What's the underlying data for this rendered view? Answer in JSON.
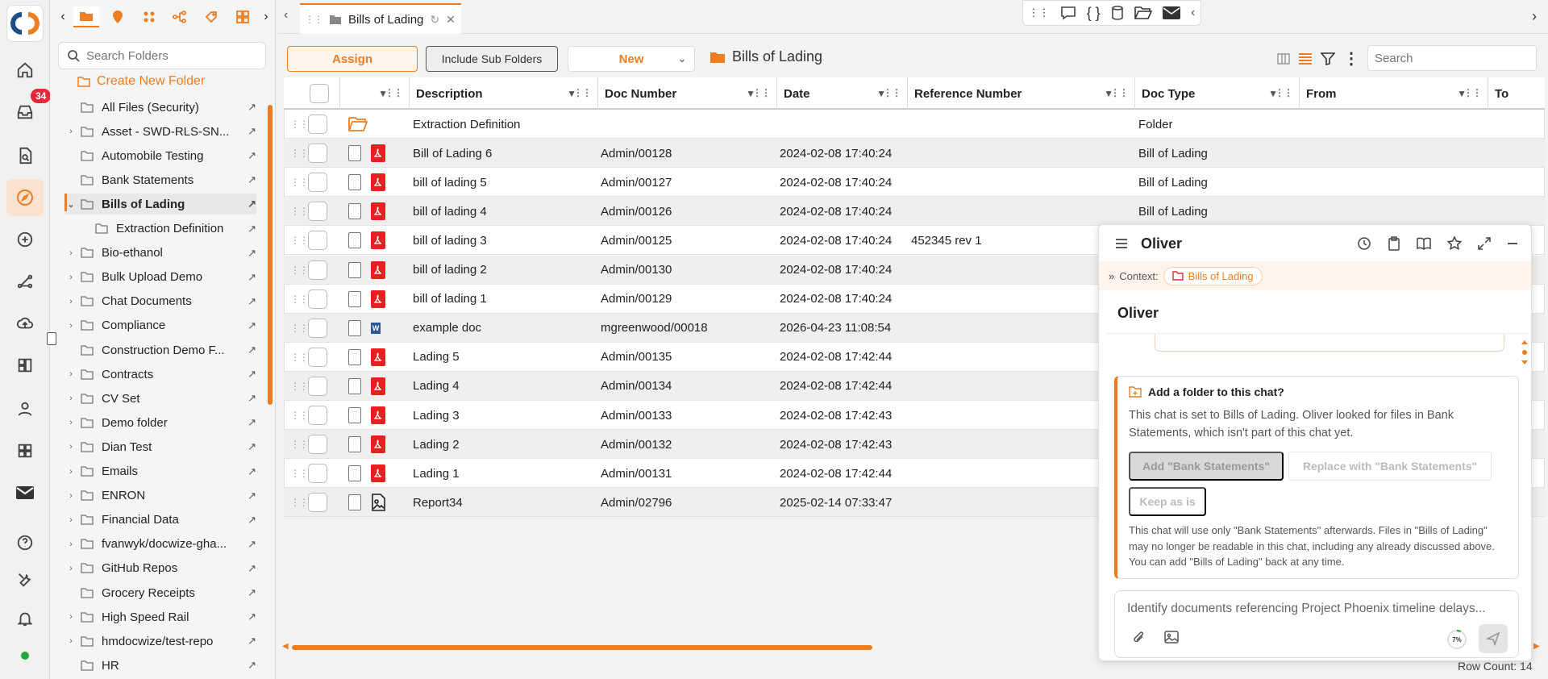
{
  "folder_panel": {
    "search_placeholder": "Search Folders",
    "create_label": "Create New Folder",
    "items": [
      {
        "label": "All Files (Security)",
        "expandable": false
      },
      {
        "label": "Asset - SWD-RLS-SN...",
        "expandable": true
      },
      {
        "label": "Automobile Testing",
        "expandable": false
      },
      {
        "label": "Bank Statements",
        "expandable": false
      },
      {
        "label": "Bills of Lading",
        "expandable": true
      },
      {
        "label": "Extraction Definition",
        "expandable": false
      },
      {
        "label": "Bio-ethanol",
        "expandable": true
      },
      {
        "label": "Bulk Upload Demo",
        "expandable": true
      },
      {
        "label": "Chat Documents",
        "expandable": true
      },
      {
        "label": "Compliance",
        "expandable": true
      },
      {
        "label": "Construction Demo F...",
        "expandable": false
      },
      {
        "label": "Contracts",
        "expandable": true
      },
      {
        "label": "CV Set",
        "expandable": true
      },
      {
        "label": "Demo folder",
        "expandable": true
      },
      {
        "label": "Dian Test",
        "expandable": true
      },
      {
        "label": "Emails",
        "expandable": true
      },
      {
        "label": "ENRON",
        "expandable": true
      },
      {
        "label": "Financial Data",
        "expandable": true
      },
      {
        "label": "fvanwyk/docwize-gha...",
        "expandable": true
      },
      {
        "label": "GitHub Repos",
        "expandable": true
      },
      {
        "label": "Grocery Receipts",
        "expandable": false
      },
      {
        "label": "High Speed Rail",
        "expandable": true
      },
      {
        "label": "hmdocwize/test-repo",
        "expandable": true
      },
      {
        "label": "HR",
        "expandable": false
      }
    ]
  },
  "rail": {
    "inbox_badge": "34"
  },
  "tab": {
    "label": "Bills of Lading"
  },
  "actions": {
    "assign": "Assign",
    "include_sub": "Include Sub Folders",
    "new": "New",
    "breadcrumb": "Bills of Lading",
    "search_placeholder": "Search"
  },
  "grid": {
    "columns": [
      "Description",
      "Doc Number",
      "Date",
      "Reference Number",
      "Doc Type",
      "From",
      "To"
    ],
    "rows": [
      {
        "icon": "folder",
        "description": "Extraction Definition",
        "doc_number": "",
        "date": "",
        "reference": "",
        "doc_type": "Folder"
      },
      {
        "icon": "pdf",
        "description": "Bill of Lading 6",
        "doc_number": "Admin/00128",
        "date": "2024-02-08 17:40:24",
        "reference": "",
        "doc_type": "Bill of Lading"
      },
      {
        "icon": "pdf",
        "description": "bill of lading 5",
        "doc_number": "Admin/00127",
        "date": "2024-02-08 17:40:24",
        "reference": "",
        "doc_type": "Bill of Lading"
      },
      {
        "icon": "pdf",
        "description": "bill of lading 4",
        "doc_number": "Admin/00126",
        "date": "2024-02-08 17:40:24",
        "reference": "",
        "doc_type": "Bill of Lading"
      },
      {
        "icon": "pdf",
        "description": "bill of lading 3",
        "doc_number": "Admin/00125",
        "date": "2024-02-08 17:40:24",
        "reference": "452345 rev 1",
        "doc_type": ""
      },
      {
        "icon": "pdf",
        "description": "bill of lading 2",
        "doc_number": "Admin/00130",
        "date": "2024-02-08 17:40:24",
        "reference": "",
        "doc_type": ""
      },
      {
        "icon": "pdf",
        "description": "bill of lading 1",
        "doc_number": "Admin/00129",
        "date": "2024-02-08 17:40:24",
        "reference": "",
        "doc_type": ""
      },
      {
        "icon": "word",
        "description": "example doc",
        "doc_number": "mgreenwood/00018",
        "date": "2026-04-23 11:08:54",
        "reference": "",
        "doc_type": ""
      },
      {
        "icon": "pdf",
        "description": "Lading 5",
        "doc_number": "Admin/00135",
        "date": "2024-02-08 17:42:44",
        "reference": "",
        "doc_type": ""
      },
      {
        "icon": "pdf",
        "description": "Lading 4",
        "doc_number": "Admin/00134",
        "date": "2024-02-08 17:42:44",
        "reference": "",
        "doc_type": ""
      },
      {
        "icon": "pdf",
        "description": "Lading 3",
        "doc_number": "Admin/00133",
        "date": "2024-02-08 17:42:43",
        "reference": "",
        "doc_type": ""
      },
      {
        "icon": "pdf",
        "description": "Lading 2",
        "doc_number": "Admin/00132",
        "date": "2024-02-08 17:42:43",
        "reference": "",
        "doc_type": ""
      },
      {
        "icon": "pdf",
        "description": "Lading 1",
        "doc_number": "Admin/00131",
        "date": "2024-02-08 17:42:44",
        "reference": "",
        "doc_type": ""
      },
      {
        "icon": "image",
        "description": "Report34",
        "doc_number": "Admin/02796",
        "date": "2025-02-14 07:33:47",
        "reference": "",
        "doc_type": ""
      }
    ],
    "row_count": "Row Count: 14"
  },
  "chat": {
    "title": "Oliver",
    "context_label": "Context:",
    "context_chip": "Bills of Lading",
    "subtitle": "Oliver",
    "notice_title": "Add a folder to this chat?",
    "notice_body": "This chat is set to Bills of Lading. Oliver looked for files in Bank Statements, which isn't part of this chat yet.",
    "add_button": "Add \"Bank Statements\"",
    "replace_button": "Replace with \"Bank Statements\"",
    "keep_button": "Keep as is",
    "notice_footer": "This chat will use only \"Bank Statements\" afterwards. Files in \"Bills of Lading\" may no longer be readable in this chat, including any already discussed above. You can add \"Bills of Lading\" back at any time.",
    "input_text": "Identify documents referencing Project Phoenix timeline delays...",
    "progress_label": "7%",
    "progress_value": 0.07
  },
  "colors": {
    "accent": "#ef7d22",
    "badge": "#e8273a",
    "pdf": "#e62020",
    "online": "#1fa83a"
  }
}
